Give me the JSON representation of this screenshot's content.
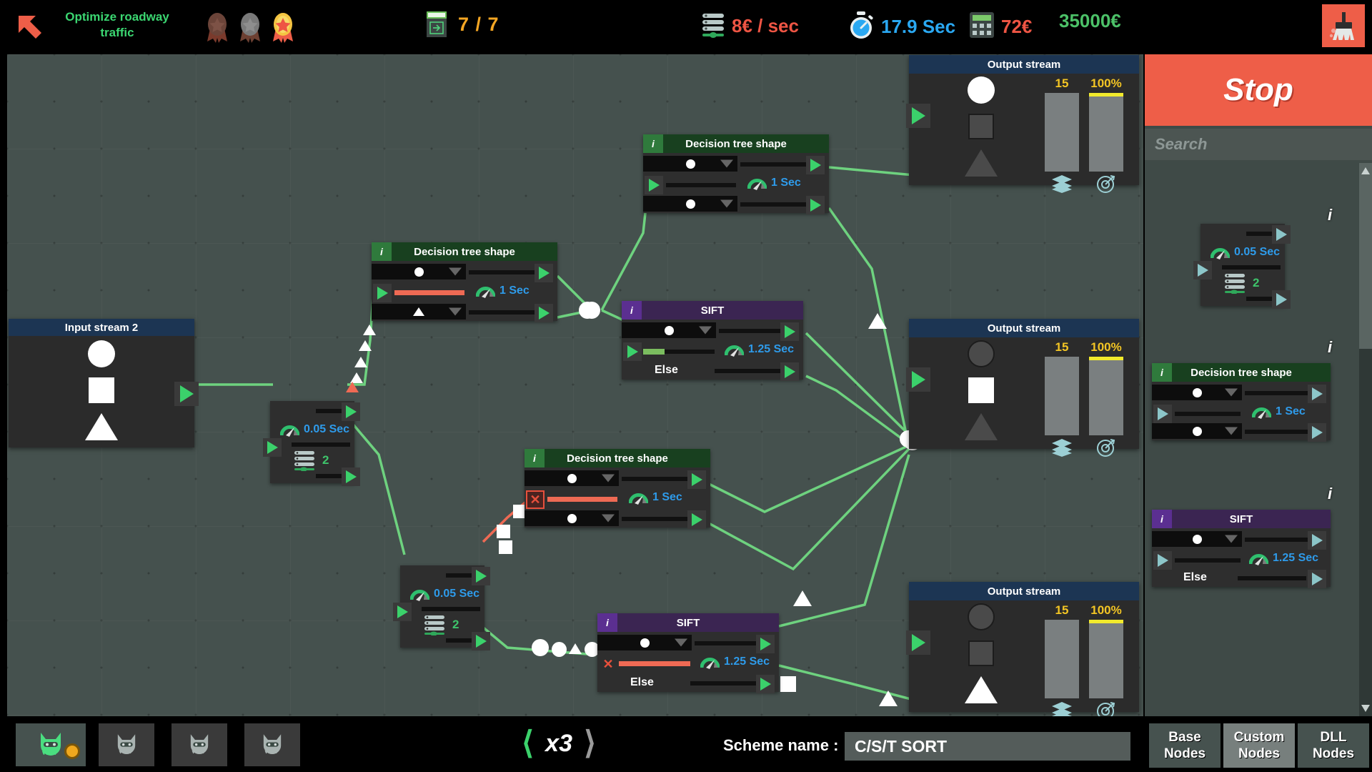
{
  "topbar": {
    "back_icon": "back-arrow-icon",
    "task_title": "Optimize roadway traffic",
    "medals": [
      {
        "name": "medal-bronze-locked",
        "color": "#6b4439",
        "star": "#7d5246"
      },
      {
        "name": "medal-silver-locked",
        "color": "#7a7a7a",
        "star": "#8e8e8e"
      },
      {
        "name": "medal-gold-earned",
        "color": "#f5c542",
        "star": "#ee5544"
      }
    ],
    "level_counter": "7 / 7",
    "cost_per_sec": "8€ / sec",
    "elapsed_time": "17.9 Sec",
    "calc_cost": "72€",
    "money": "35000€",
    "clear_icon": "broom-icon"
  },
  "canvas": {
    "input_stream": {
      "title": "Input stream 2",
      "shapes": [
        {
          "name": "circle",
          "state": "on"
        },
        {
          "name": "square",
          "state": "on"
        },
        {
          "name": "triangle",
          "state": "on"
        }
      ]
    },
    "output_streams": [
      {
        "title": "Output stream",
        "shapes": [
          {
            "name": "circle",
            "state": "on"
          },
          {
            "name": "square",
            "state": "off"
          },
          {
            "name": "triangle",
            "state": "off"
          }
        ],
        "count": "15",
        "percent": "100%",
        "count_icon": "layers-icon",
        "percent_icon": "target-icon"
      },
      {
        "title": "Output stream",
        "shapes": [
          {
            "name": "circle",
            "state": "off"
          },
          {
            "name": "square",
            "state": "on"
          },
          {
            "name": "triangle",
            "state": "off"
          }
        ],
        "count": "15",
        "percent": "100%",
        "count_icon": "layers-icon",
        "percent_icon": "target-icon"
      },
      {
        "title": "Output stream",
        "shapes": [
          {
            "name": "circle",
            "state": "off"
          },
          {
            "name": "square",
            "state": "off"
          },
          {
            "name": "triangle",
            "state": "on"
          }
        ],
        "count": "15",
        "percent": "100%",
        "count_icon": "layers-icon",
        "percent_icon": "target-icon"
      }
    ],
    "nodes": [
      {
        "id": "dtree-top",
        "title": "Decision tree shape",
        "badge": "i",
        "delay": "1 Sec",
        "type": "decision"
      },
      {
        "id": "dtree-mid",
        "title": "Decision tree shape",
        "badge": "i",
        "delay": "1 Sec",
        "type": "decision"
      },
      {
        "id": "dtree-low",
        "title": "Decision tree shape",
        "badge": "i",
        "delay": "1 Sec",
        "type": "decision",
        "error": true
      },
      {
        "id": "sift-top",
        "title": "SIFT",
        "badge": "i",
        "delay": "1.25 Sec",
        "else_label": "Else",
        "type": "sift"
      },
      {
        "id": "sift-low",
        "title": "SIFT",
        "badge": "i",
        "delay": "1.25 Sec",
        "else_label": "Else",
        "type": "sift",
        "error": true
      }
    ],
    "splitters": [
      {
        "id": "split-upper",
        "delay": "0.05 Sec",
        "outputs": "2"
      },
      {
        "id": "split-lower",
        "delay": "0.05 Sec",
        "outputs": "2"
      }
    ]
  },
  "right_panel": {
    "stop_label": "Stop",
    "search_placeholder": "Search",
    "palette": [
      {
        "type": "splitter",
        "delay": "0.05 Sec",
        "outputs": "2",
        "info": "i"
      },
      {
        "type": "decision",
        "title": "Decision tree shape",
        "badge": "i",
        "delay": "1 Sec",
        "info": "i"
      },
      {
        "type": "sift",
        "title": "SIFT",
        "badge": "i",
        "delay": "1.25 Sec",
        "else_label": "Else",
        "info": "i"
      }
    ],
    "scroll_up_icon": "triangle-up-icon",
    "scroll_down_icon": "triangle-down-icon"
  },
  "bottom": {
    "scheme_tabs": [
      {
        "name": "scheme-tab-1",
        "icon": "cat-icon",
        "active": true,
        "has_dot": true
      },
      {
        "name": "scheme-tab-2",
        "icon": "cat-icon",
        "active": false,
        "has_dot": false
      },
      {
        "name": "scheme-tab-3",
        "icon": "cat-icon",
        "active": false,
        "has_dot": false
      },
      {
        "name": "scheme-tab-4",
        "icon": "cat-icon",
        "active": false,
        "has_dot": false
      }
    ],
    "speed_prev_icon": "chevron-left-icon",
    "speed_value": "x3",
    "speed_next_icon": "chevron-right-icon",
    "scheme_name_label": "Scheme name :",
    "scheme_name_value": "C/S/T SORT",
    "node_tabs": [
      {
        "label_line1": "Base",
        "label_line2": "Nodes",
        "selected": false
      },
      {
        "label_line1": "Custom",
        "label_line2": "Nodes",
        "selected": true
      },
      {
        "label_line1": "DLL",
        "label_line2": "Nodes",
        "selected": false
      }
    ]
  },
  "colors": {
    "accent_green": "#3bd671",
    "stop_red": "#ee5e48",
    "time_blue": "#2aa8f2",
    "money_green": "#4cc168",
    "cost_red": "#ee5544",
    "counter_orange": "#f5a623",
    "meter_yellow": "#f3c524",
    "canvas_bg": "#45514e",
    "wire_green": "#6ed27f"
  }
}
